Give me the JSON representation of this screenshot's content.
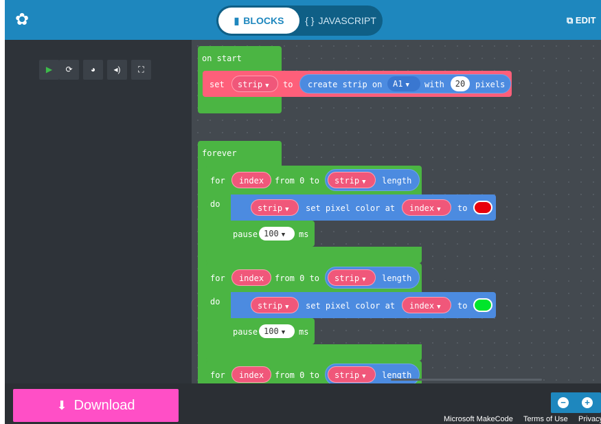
{
  "header": {
    "logo_icon": "adafruit-star-icon",
    "tabs": {
      "blocks": "BLOCKS",
      "javascript": "JAVASCRIPT"
    },
    "edit_label": "EDIT"
  },
  "simulator": {
    "buttons": [
      "play-icon",
      "restart-icon",
      "snail-icon",
      "sound-icon",
      "fullscreen-icon"
    ]
  },
  "blocks": {
    "on_start": {
      "label": "on start",
      "set": "set",
      "var": "strip",
      "to": "to",
      "create": "create strip on",
      "pin": "A1",
      "with": "with",
      "count": "20",
      "pixels": "pixels"
    },
    "forever": {
      "label": "forever",
      "loops": [
        {
          "for": "for",
          "index": "index",
          "from": "from 0 to",
          "strip": "strip",
          "length": "length",
          "do": "do",
          "set_pixel": "set pixel color at",
          "to": "to",
          "color": "#e8000b",
          "pause": "pause",
          "ms_value": "100",
          "ms": "ms"
        },
        {
          "for": "for",
          "index": "index",
          "from": "from 0 to",
          "strip": "strip",
          "length": "length",
          "do": "do",
          "set_pixel": "set pixel color at",
          "to": "to",
          "color": "#00e52b",
          "pause": "pause",
          "ms_value": "100",
          "ms": "ms"
        },
        {
          "for": "for",
          "index": "index",
          "from": "from 0 to",
          "strip": "strip",
          "length": "length"
        }
      ]
    }
  },
  "bottom": {
    "download": "Download",
    "zoom_out": "−",
    "zoom_in": "+",
    "footer": {
      "makecode": "Microsoft MakeCode",
      "terms": "Terms of Use",
      "privacy": "Privacy"
    }
  },
  "colors": {
    "header": "#1e87be",
    "loops_green": "#4bb543",
    "variables_red": "#fe5f7a",
    "neopixel_blue": "#4c8be0",
    "download_pink": "#ff4fc6"
  }
}
